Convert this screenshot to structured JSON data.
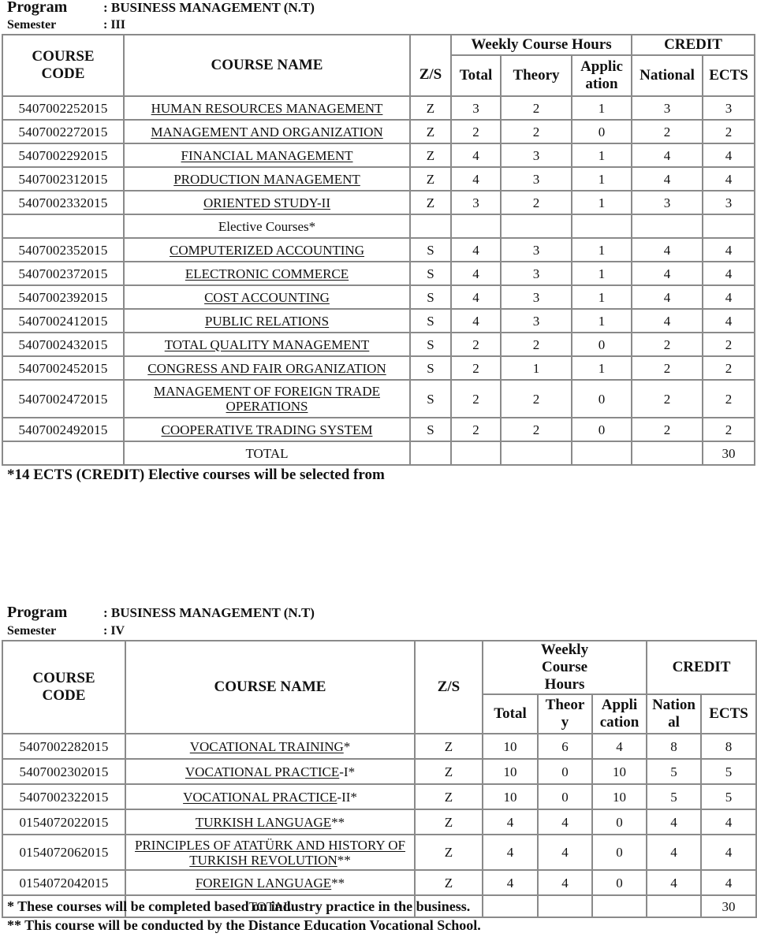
{
  "semester3": {
    "program_label": "Program",
    "program_value": ": BUSINESS MANAGEMENT (N.T)",
    "semester_label": "Semester",
    "semester_value": ": III",
    "headers": {
      "course_code": "COURSE CODE",
      "course_name": "COURSE NAME",
      "zs": "Z/S",
      "weekly_hours": "Weekly Course Hours",
      "credit": "CREDIT",
      "total": "Total",
      "theory": "Theory",
      "application": "Applic ation",
      "national": "National",
      "ects": "ECTS"
    },
    "rows": [
      {
        "code": "5407002252015",
        "name": "HUMAN RESOURCES MANAGEMENT",
        "zs": "Z",
        "total": "3",
        "theory": "2",
        "application": "1",
        "national": "3",
        "ects": "3"
      },
      {
        "code": "5407002272015",
        "name": "MANAGEMENT AND ORGANIZATION",
        "zs": "Z",
        "total": "2",
        "theory": "2",
        "application": "0",
        "national": "2",
        "ects": "2"
      },
      {
        "code": "5407002292015",
        "name": "FINANCIAL MANAGEMENT",
        "zs": "Z",
        "total": "4",
        "theory": "3",
        "application": "1",
        "national": "4",
        "ects": "4"
      },
      {
        "code": "5407002312015",
        "name": "PRODUCTION MANAGEMENT",
        "zs": "Z",
        "total": "4",
        "theory": "3",
        "application": "1",
        "national": "4",
        "ects": "4"
      },
      {
        "code": "5407002332015",
        "name": "ORIENTED STUDY-II",
        "zs": "Z",
        "total": "3",
        "theory": "2",
        "application": "1",
        "national": "3",
        "ects": "3"
      }
    ],
    "elective_heading": "Elective Courses*",
    "elective_rows": [
      {
        "code": "5407002352015",
        "name": "COMPUTERIZED ACCOUNTING",
        "zs": "S",
        "total": "4",
        "theory": "3",
        "application": "1",
        "national": "4",
        "ects": "4"
      },
      {
        "code": "5407002372015",
        "name": "ELECTRONIC COMMERCE",
        "zs": "S",
        "total": "4",
        "theory": "3",
        "application": "1",
        "national": "4",
        "ects": "4"
      },
      {
        "code": "5407002392015",
        "name": "COST ACCOUNTING",
        "zs": "S",
        "total": "4",
        "theory": "3",
        "application": "1",
        "national": "4",
        "ects": "4"
      },
      {
        "code": "5407002412015",
        "name": "PUBLIC RELATIONS",
        "zs": "S",
        "total": "4",
        "theory": "3",
        "application": "1",
        "national": "4",
        "ects": "4"
      },
      {
        "code": "5407002432015",
        "name": "TOTAL QUALITY MANAGEMENT",
        "zs": "S",
        "total": "2",
        "theory": "2",
        "application": "0",
        "national": "2",
        "ects": "2"
      },
      {
        "code": "5407002452015",
        "name": "CONGRESS AND FAIR ORGANIZATION",
        "zs": "S",
        "total": "2",
        "theory": "1",
        "application": "1",
        "national": "2",
        "ects": "2"
      },
      {
        "code": "5407002472015",
        "name": "MANAGEMENT OF FOREIGN TRADE OPERATIONS",
        "zs": "S",
        "total": "2",
        "theory": "2",
        "application": "0",
        "national": "2",
        "ects": "2"
      },
      {
        "code": "5407002492015",
        "name": "COOPERATIVE TRADING SYSTEM",
        "zs": "S",
        "total": "2",
        "theory": "2",
        "application": "0",
        "national": "2",
        "ects": "2"
      }
    ],
    "total_label": "TOTAL",
    "total_ects": "30",
    "footnote": "*14  ECTS (CREDIT) Elective courses will be selected from"
  },
  "semester4": {
    "program_label": "Program",
    "program_value": ": BUSINESS MANAGEMENT (N.T)",
    "semester_label": "Semester",
    "semester_value": ": IV",
    "headers": {
      "course_code": "COURSE CODE",
      "course_name": "COURSE NAME",
      "zs": "Z/S",
      "weekly_hours": "Weekly Course Hours",
      "credit": "CREDIT",
      "total": "Total",
      "theory": "Theor y",
      "application": "Appli cation",
      "national": "Nation al",
      "ects": "ECTS"
    },
    "rows": [
      {
        "code": "5407002282015",
        "name": "VOCATIONAL TRAINING",
        "suffix": "*",
        "zs": "Z",
        "total": "10",
        "theory": "6",
        "application": "4",
        "national": "8",
        "ects": "8"
      },
      {
        "code": "5407002302015",
        "name": "VOCATIONAL PRACTICE",
        "suffix": "-I*",
        "zs": "Z",
        "total": "10",
        "theory": "0",
        "application": "10",
        "national": "5",
        "ects": "5"
      },
      {
        "code": "5407002322015",
        "name": "VOCATIONAL PRACTICE",
        "suffix": "-II*",
        "zs": "Z",
        "total": "10",
        "theory": "0",
        "application": "10",
        "national": "5",
        "ects": "5"
      },
      {
        "code": "0154072022015",
        "name": "TURKISH LANGUAGE",
        "suffix": "**",
        "zs": "Z",
        "total": "4",
        "theory": "4",
        "application": "0",
        "national": "4",
        "ects": "4"
      },
      {
        "code": "0154072062015",
        "name": "PRINCIPLES OF ATATÜRK AND HISTORY OF TURKISH REVOLUTION",
        "suffix": "**",
        "zs": "Z",
        "total": "4",
        "theory": "4",
        "application": "0",
        "national": "4",
        "ects": "4"
      },
      {
        "code": "0154072042015",
        "name": "FOREIGN LANGUAGE",
        "suffix": "**",
        "zs": "Z",
        "total": "4",
        "theory": "4",
        "application": "0",
        "national": "4",
        "ects": "4"
      }
    ],
    "total_label": "TOTAL",
    "total_ects": "30",
    "footnote1": "* These courses will be completed based on industry practice in the business.",
    "footnote2": "** This course will be conducted by the Distance Education Vocational School."
  }
}
